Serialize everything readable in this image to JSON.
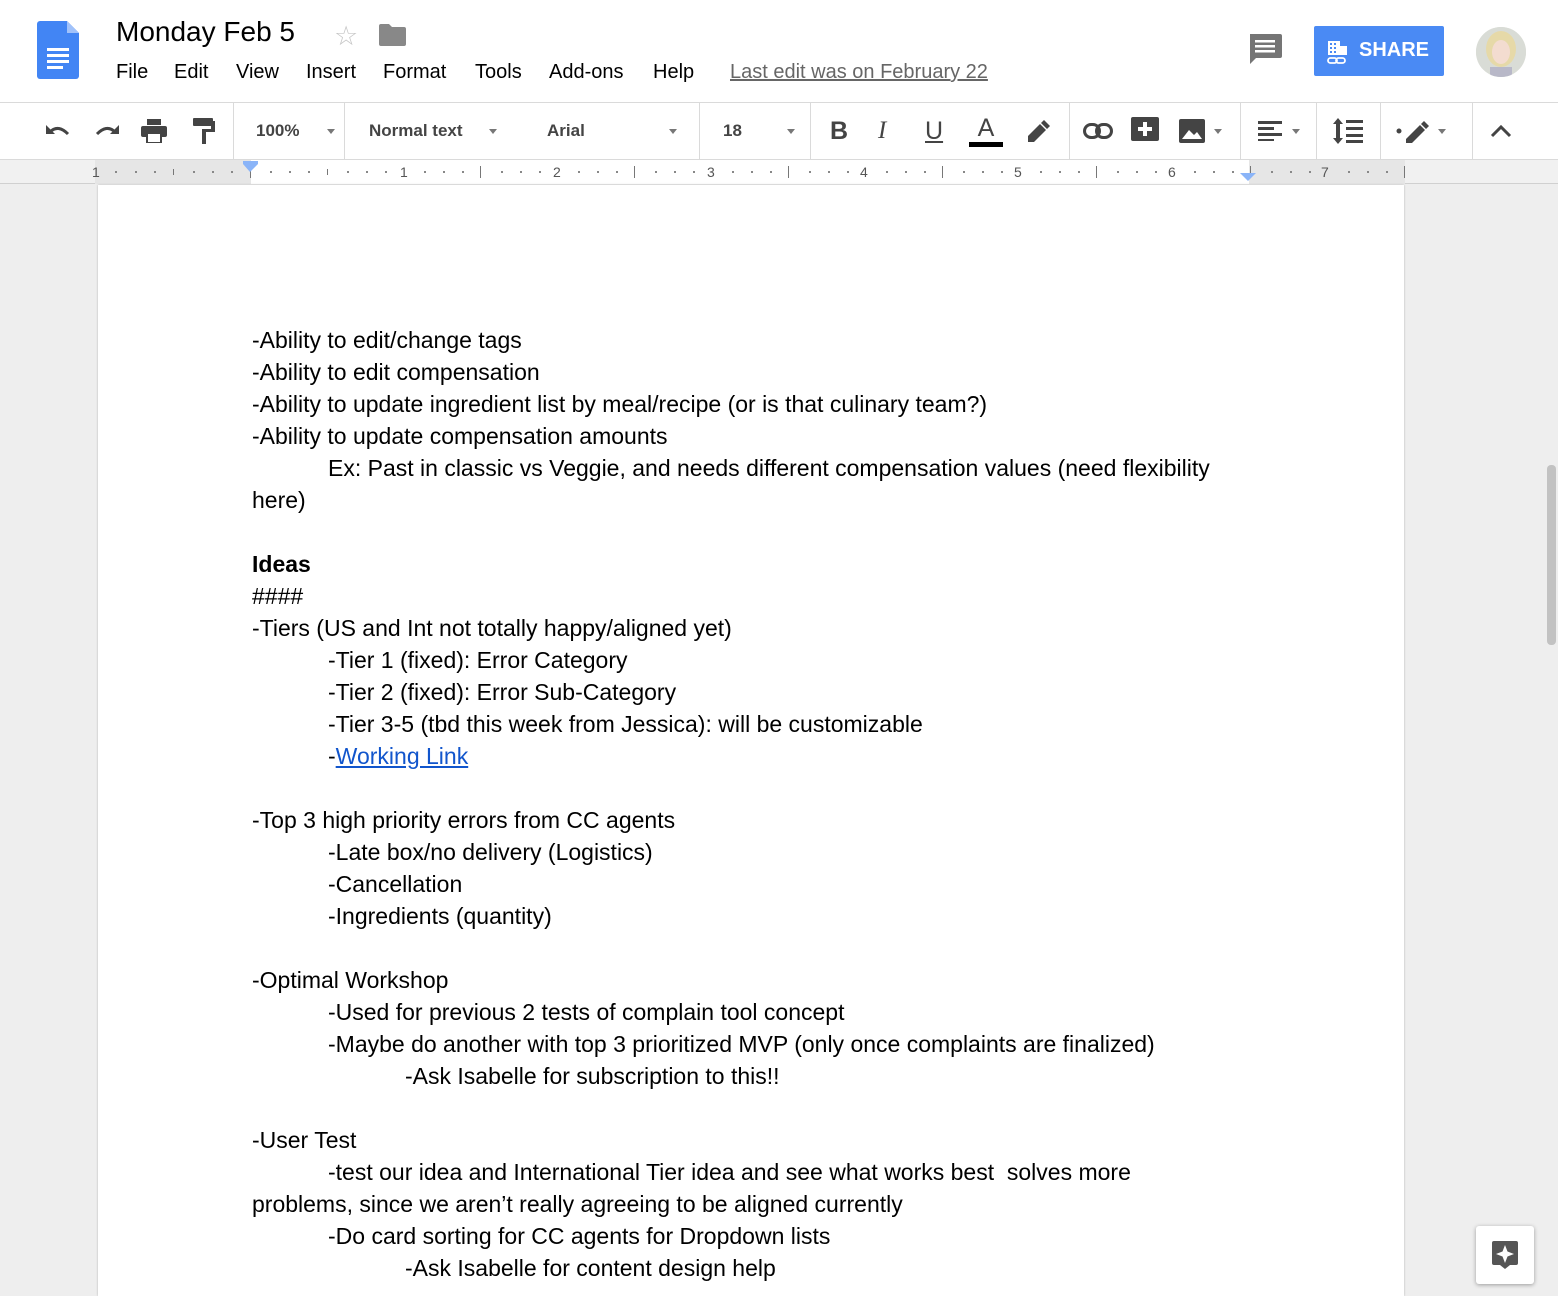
{
  "header": {
    "title": "Monday Feb 5",
    "last_edit": "Last edit was on February 22",
    "share_label": "SHARE",
    "menu": [
      "File",
      "Edit",
      "View",
      "Insert",
      "Format",
      "Tools",
      "Add-ons",
      "Help"
    ]
  },
  "toolbar": {
    "zoom": "100%",
    "style": "Normal text",
    "font": "Arial",
    "font_size": "18",
    "bold_label": "B",
    "italic_label": "I",
    "underline_label": "U",
    "text_color_label": "A"
  },
  "ruler": {
    "numbers": [
      "1",
      "1",
      "2",
      "3",
      "4",
      "5",
      "6",
      "7"
    ]
  },
  "document": {
    "lines": [
      {
        "text": "-Ability to edit/change tags",
        "indent": 0
      },
      {
        "text": "-Ability to edit compensation",
        "indent": 0
      },
      {
        "text": "-Ability to update ingredient list by meal/recipe (or is that culinary team?)",
        "indent": 0
      },
      {
        "text": "-Ability to update compensation amounts",
        "indent": 0
      },
      {
        "text": "Ex: Past in classic vs Veggie, and needs different compensation values (need flexibility",
        "indent": 1
      },
      {
        "text": "here)",
        "indent": 0
      },
      {
        "text": "",
        "indent": 0
      },
      {
        "text": "Ideas",
        "indent": 0,
        "bold": true
      },
      {
        "text": "####",
        "indent": 0
      },
      {
        "text": "-Tiers (US and Int not totally happy/aligned yet)",
        "indent": 0
      },
      {
        "text": "-Tier 1 (fixed): Error Category",
        "indent": 1
      },
      {
        "text": "-Tier 2 (fixed): Error Sub-Category",
        "indent": 1
      },
      {
        "text": "-Tier 3-5 (tbd this week from Jessica): will be customizable",
        "indent": 1
      },
      {
        "text": "-",
        "indent": 1,
        "link": "Working Link"
      },
      {
        "text": "",
        "indent": 0
      },
      {
        "text": "-Top 3 high priority errors from CC agents",
        "indent": 0
      },
      {
        "text": "-Late box/no delivery (Logistics)",
        "indent": 1
      },
      {
        "text": "-Cancellation",
        "indent": 1
      },
      {
        "text": "-Ingredients (quantity)",
        "indent": 1
      },
      {
        "text": "",
        "indent": 0
      },
      {
        "text": "-Optimal Workshop",
        "indent": 0
      },
      {
        "text": "-Used for previous 2 tests of complain tool concept",
        "indent": 1
      },
      {
        "text": "-Maybe do another with top 3 prioritized MVP (only once complaints are finalized)",
        "indent": 1
      },
      {
        "text": "-Ask Isabelle for subscription to this!!",
        "indent": 2
      },
      {
        "text": "",
        "indent": 0
      },
      {
        "text": "-User Test",
        "indent": 0
      },
      {
        "text": "-test our idea and International Tier idea and see what works best  solves more",
        "indent": 1
      },
      {
        "text": "problems, since we aren’t really agreeing to be aligned currently",
        "indent": 0
      },
      {
        "text": "-Do card sorting for CC agents for Dropdown lists",
        "indent": 1
      },
      {
        "text": "-Ask Isabelle for content design help",
        "indent": 2
      }
    ]
  }
}
